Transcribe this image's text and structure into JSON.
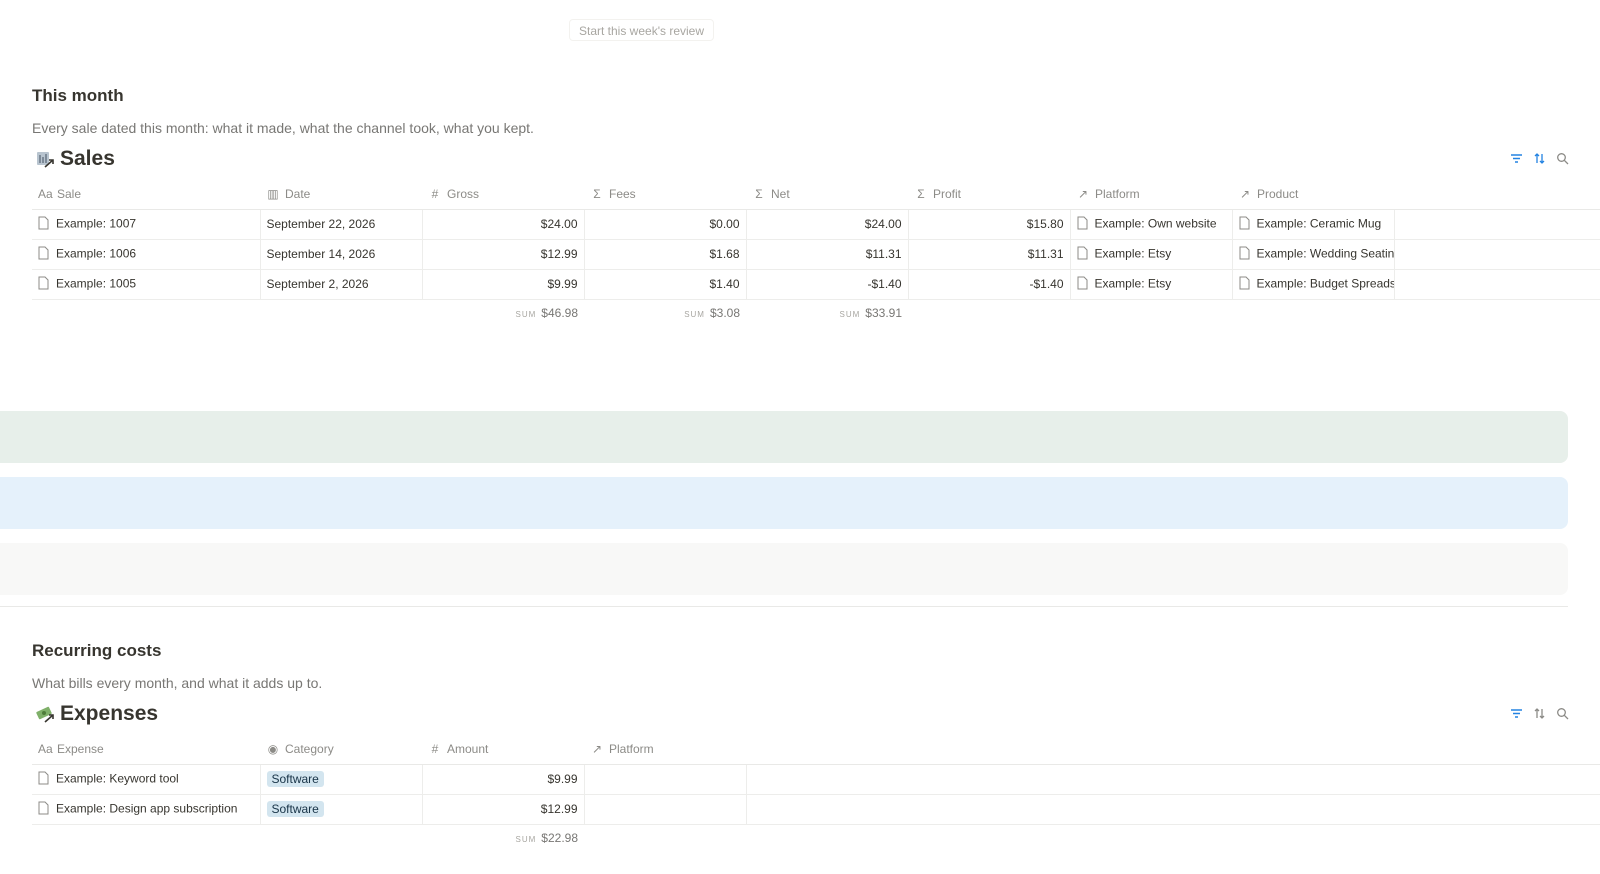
{
  "top_button": "Start this week's review",
  "this_month": {
    "title": "This month",
    "description": "Every sale dated this month: what it made, what the channel took, what you kept."
  },
  "sales": {
    "title": "Sales",
    "columns": [
      "Sale",
      "Date",
      "Gross",
      "Fees",
      "Net",
      "Profit",
      "Platform",
      "Product"
    ],
    "rows": [
      {
        "sale": "Example: 1007",
        "date": "September 22, 2026",
        "gross": "$24.00",
        "fees": "$0.00",
        "net": "$24.00",
        "profit": "$15.80",
        "platform": "Example: Own website",
        "product": "Example: Ceramic Mug"
      },
      {
        "sale": "Example: 1006",
        "date": "September 14, 2026",
        "gross": "$12.99",
        "fees": "$1.68",
        "net": "$11.31",
        "profit": "$11.31",
        "platform": "Example: Etsy",
        "product": "Example: Wedding Seating"
      },
      {
        "sale": "Example: 1005",
        "date": "September 2, 2026",
        "gross": "$9.99",
        "fees": "$1.40",
        "net": "-$1.40",
        "profit": "-$1.40",
        "platform": "Example: Etsy",
        "product": "Example: Budget Spreadsh"
      }
    ],
    "sum_label": "SUM",
    "sums": {
      "gross": "$46.98",
      "fees": "$3.08",
      "net": "$33.91"
    }
  },
  "bands": {
    "colors": [
      "#e7efea",
      "#e5f1fb",
      "#f8f8f7"
    ]
  },
  "recurring": {
    "title": "Recurring costs",
    "description": "What bills every month, and what it adds up to."
  },
  "expenses": {
    "title": "Expenses",
    "columns": [
      "Expense",
      "Category",
      "Amount",
      "Platform"
    ],
    "rows": [
      {
        "expense": "Example: Keyword tool",
        "category": "Software",
        "amount": "$9.99",
        "platform": ""
      },
      {
        "expense": "Example: Design app subscription",
        "category": "Software",
        "amount": "$12.99",
        "platform": ""
      }
    ],
    "sum_label": "SUM",
    "sums": {
      "amount": "$22.98"
    }
  },
  "colors": {
    "accent": "#2383e2",
    "tag_bg": "#d3e5ef"
  }
}
